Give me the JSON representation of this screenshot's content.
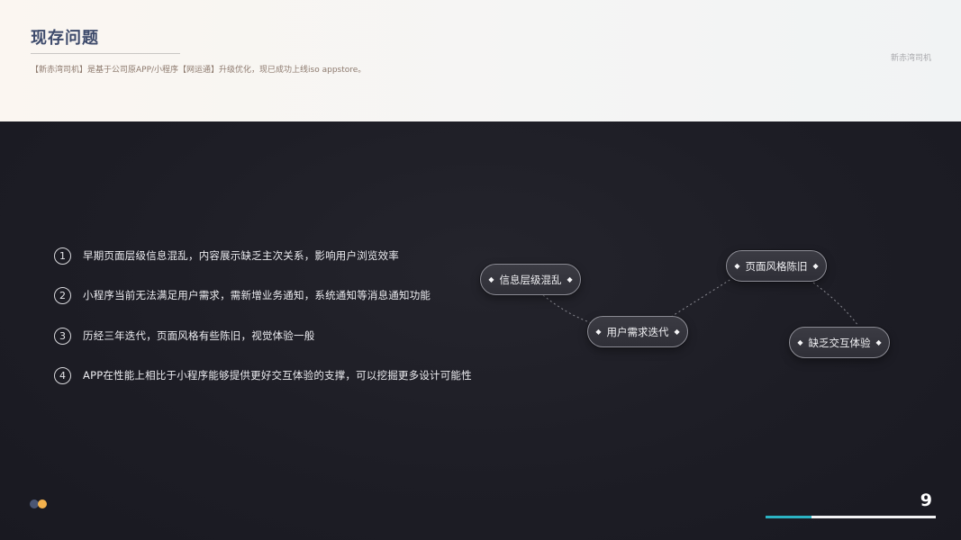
{
  "header": {
    "title": "现存问题",
    "subtitle": "【新赤湾司机】是基于公司原APP/小程序【网运通】升级优化，现已成功上线iso appstore。",
    "brand": "新赤湾司机"
  },
  "issues": [
    {
      "num": "1",
      "text": "早期页面层级信息混乱，内容展示缺乏主次关系，影响用户浏览效率"
    },
    {
      "num": "2",
      "text": "小程序当前无法满足用户需求，需新增业务通知，系统通知等消息通知功能"
    },
    {
      "num": "3",
      "text": "历经三年迭代，页面风格有些陈旧，视觉体验一般"
    },
    {
      "num": "4",
      "text": "APP在性能上相比于小程序能够提供更好交互体验的支撑，可以挖掘更多设计可能性"
    }
  ],
  "tags": [
    {
      "label": "信息层级混乱"
    },
    {
      "label": "用户需求迭代"
    },
    {
      "label": "页面风格陈旧"
    },
    {
      "label": "缺乏交互体验"
    }
  ],
  "tag_marker": "◆",
  "footer": {
    "page_number": "9",
    "progress_fraction": 0.27,
    "progress_color": "#2bb3c3"
  },
  "colors": {
    "title": "#3d4a6b",
    "dot_primary": "#4b5674",
    "dot_accent": "#f4b24d"
  }
}
